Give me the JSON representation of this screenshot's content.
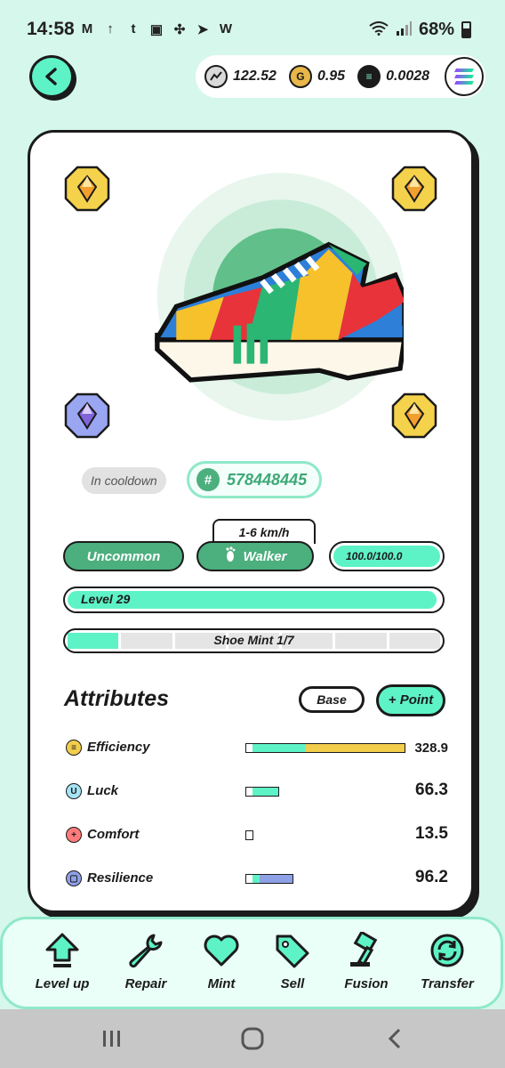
{
  "status": {
    "time": "14:58",
    "notif_icons": [
      "M",
      "↑",
      "t",
      "▣",
      "✣",
      "➤",
      "W"
    ],
    "battery": "68%"
  },
  "wallet": {
    "gst": "122.52",
    "gmt": "0.95",
    "sol": "0.0028"
  },
  "sneaker": {
    "status": "In cooldown",
    "id": "578448445",
    "speed_range": "1-6 km/h",
    "rarity": "Uncommon",
    "type": "Walker",
    "energy": "100.0/100.0",
    "level_label": "Level 29",
    "level_progress": 0.99,
    "mint_label": "Shoe Mint 1/7",
    "mint_used": 1,
    "mint_total": 7
  },
  "attributes": {
    "title": "Attributes",
    "base_label": "Base",
    "point_label": "+ Point",
    "rows": [
      {
        "label": "Efficiency",
        "value": "328.9",
        "base": 13.5,
        "plus": 315.4,
        "icon": "efficiency-icon",
        "color": "#f2cd4c"
      },
      {
        "label": "Luck",
        "value": "66.3",
        "base": 13.5,
        "plus": 52.8,
        "icon": "luck-icon",
        "color": "#5ef3c6"
      },
      {
        "label": "Comfort",
        "value": "13.5",
        "base": 13.5,
        "plus": 0,
        "icon": "comfort-icon",
        "color": "#ff7b7b"
      },
      {
        "label": "Resilience",
        "value": "96.2",
        "base": 13.5,
        "plus": 82.7,
        "icon": "resilience-icon",
        "color": "#8ea0e6"
      }
    ]
  },
  "actions": [
    {
      "label": "Level up",
      "icon": "level-up-icon"
    },
    {
      "label": "Repair",
      "icon": "wrench-icon"
    },
    {
      "label": "Mint",
      "icon": "heart-icon"
    },
    {
      "label": "Sell",
      "icon": "tag-icon"
    },
    {
      "label": "Fusion",
      "icon": "hammer-icon"
    },
    {
      "label": "Transfer",
      "icon": "transfer-icon"
    }
  ],
  "colors": {
    "background": "#d6f7eb",
    "accent": "#5ef3c6",
    "green": "#4caf7e"
  }
}
